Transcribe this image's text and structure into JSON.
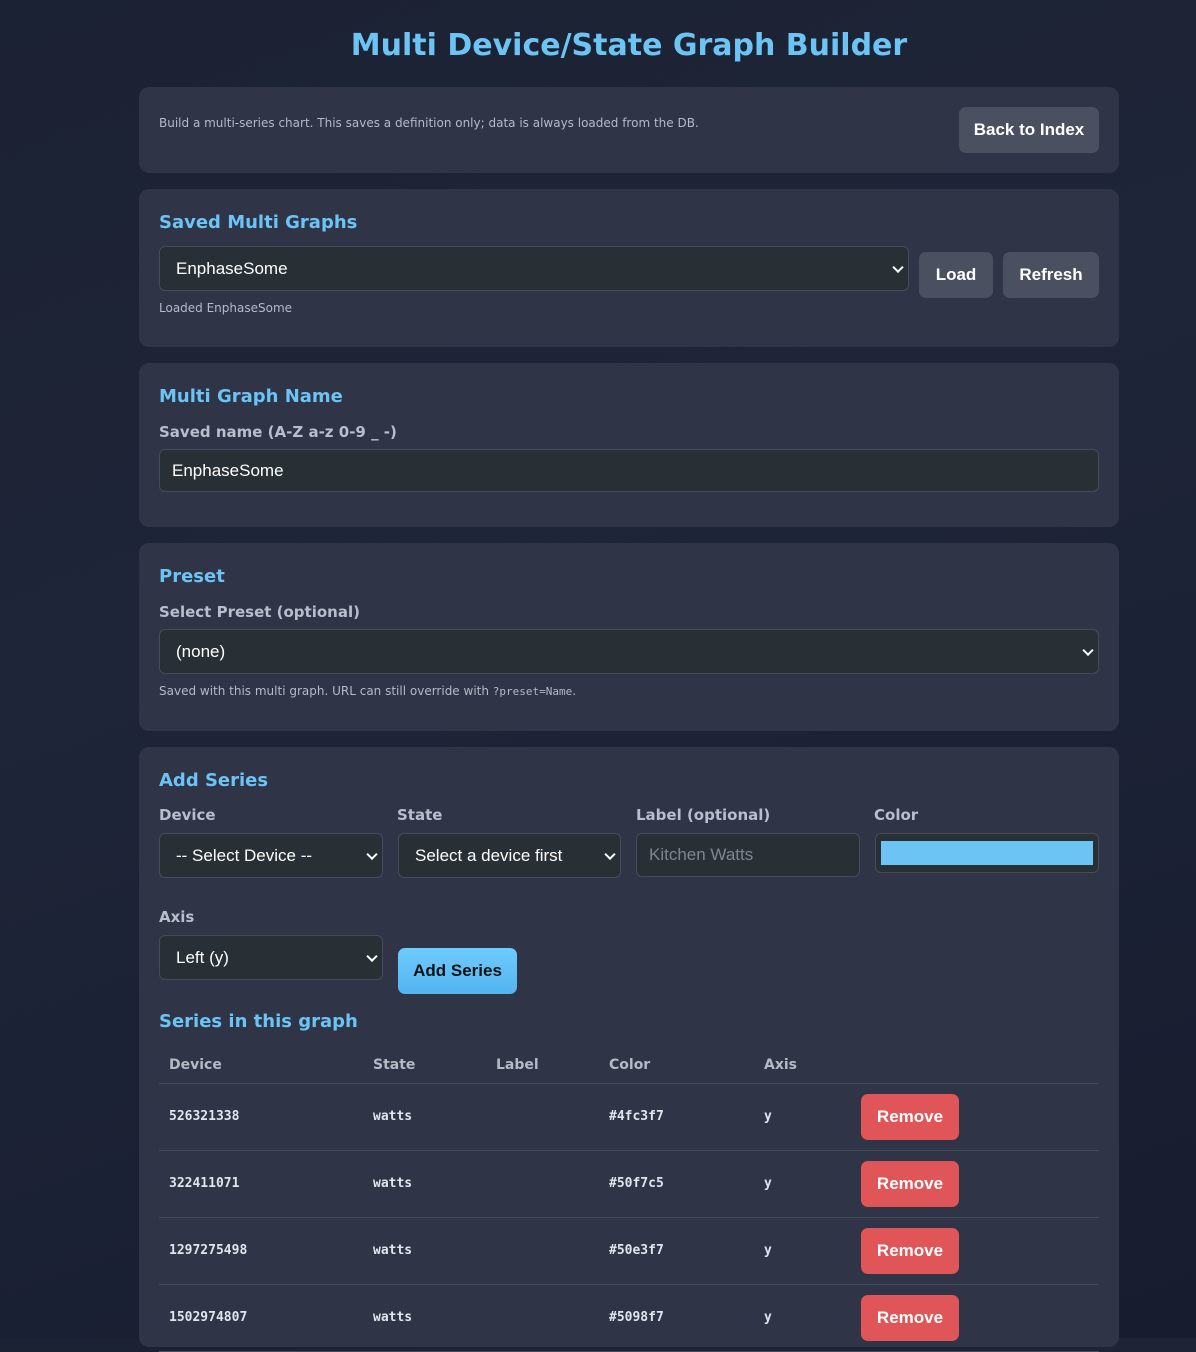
{
  "page": {
    "title": "Multi Device/State Graph Builder"
  },
  "intro": {
    "description": "Build a multi-series chart. This saves a definition only; data is always loaded from the DB.",
    "back_label": "Back to Index"
  },
  "saved": {
    "heading": "Saved Multi Graphs",
    "selected": "EnphaseSome",
    "load_label": "Load",
    "refresh_label": "Refresh",
    "status": "Loaded EnphaseSome"
  },
  "name_section": {
    "heading": "Multi Graph Name",
    "field_label": "Saved name (A-Z a-z 0-9 _ -)",
    "value": "EnphaseSome"
  },
  "preset": {
    "heading": "Preset",
    "field_label": "Select Preset (optional)",
    "selected": "(none)",
    "hint_prefix": "Saved with this multi graph. URL can still override with ",
    "hint_code": "?preset=Name",
    "hint_suffix": "."
  },
  "add_series": {
    "heading": "Add Series",
    "device_label": "Device",
    "device_selected": "-- Select Device --",
    "state_label": "State",
    "state_selected": "Select a device first",
    "label_label": "Label (optional)",
    "label_placeholder": "Kitchen Watts",
    "color_label": "Color",
    "color_value": "#6cc4f5",
    "axis_label": "Axis",
    "axis_selected": "Left (y)",
    "add_label": "Add Series"
  },
  "series_table": {
    "heading": "Series in this graph",
    "columns": [
      "Device",
      "State",
      "Label",
      "Color",
      "Axis"
    ],
    "remove_label": "Remove",
    "rows": [
      {
        "device": "526321338",
        "state": "watts",
        "label": "",
        "color": "#4fc3f7",
        "axis": "y"
      },
      {
        "device": "322411071",
        "state": "watts",
        "label": "",
        "color": "#50f7c5",
        "axis": "y"
      },
      {
        "device": "1297275498",
        "state": "watts",
        "label": "",
        "color": "#50e3f7",
        "axis": "y"
      },
      {
        "device": "1502974807",
        "state": "watts",
        "label": "",
        "color": "#5098f7",
        "axis": "y"
      }
    ]
  }
}
